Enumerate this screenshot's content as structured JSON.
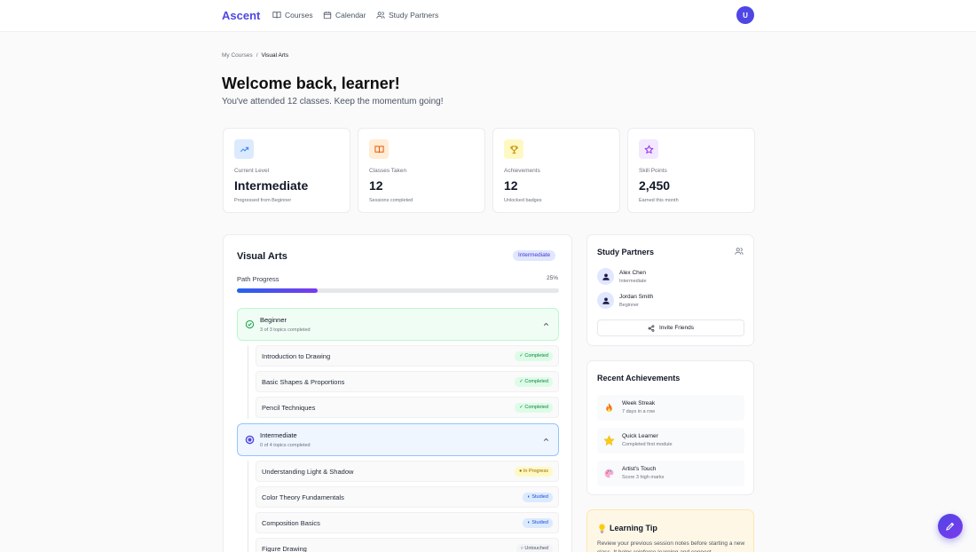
{
  "nav": {
    "brand": "Ascent",
    "items": [
      {
        "label": "Courses",
        "icon": "book-icon"
      },
      {
        "label": "Calendar",
        "icon": "calendar-icon"
      },
      {
        "label": "Study Partners",
        "icon": "users-icon"
      }
    ],
    "avatar_initial": "U"
  },
  "breadcrumb": {
    "parent": "My Courses",
    "separator": "/",
    "current": "Visual Arts"
  },
  "header": {
    "title": "Welcome back, learner!",
    "subtitle": "You've attended 12 classes. Keep the momentum going!"
  },
  "stats": [
    {
      "label": "Current Level",
      "value": "Intermediate",
      "sub": "Progressed from Beginner",
      "icon": "trending-up-icon",
      "color": "#3b82f6",
      "bg": "#dbeafe"
    },
    {
      "label": "Classes Taken",
      "value": "12",
      "sub": "Sessions completed",
      "icon": "book-open-icon",
      "color": "#ea580c",
      "bg": "#ffedd5"
    },
    {
      "label": "Achievements",
      "value": "12",
      "sub": "Unlocked badges",
      "icon": "trophy-icon",
      "color": "#ca8a04",
      "bg": "#fef9c3"
    },
    {
      "label": "Skill Points",
      "value": "2,450",
      "sub": "Earned this month",
      "icon": "star-icon",
      "color": "#9333ea",
      "bg": "#f3e8ff"
    }
  ],
  "course": {
    "title": "Visual Arts",
    "level_badge": "Intermediate",
    "progress_label": "Path Progress",
    "progress_text": "25%",
    "progress": 0.25,
    "sections": [
      {
        "title": "Beginner",
        "sub": "3 of 3 topics completed",
        "state": "done",
        "topics": [
          {
            "name": "Introduction to Drawing",
            "status": "✓ Completed"
          },
          {
            "name": "Basic Shapes & Proportions",
            "status": "✓ Completed"
          },
          {
            "name": "Pencil Techniques",
            "status": "✓ Completed"
          }
        ]
      },
      {
        "title": "Intermediate",
        "sub": "0 of 4 topics completed",
        "state": "active",
        "topics": [
          {
            "name": "Understanding Light & Shadow",
            "status": "● In Progress"
          },
          {
            "name": "Color Theory Fundamentals",
            "status": "◐ Studied"
          },
          {
            "name": "Composition Basics",
            "status": "◐ Studied"
          },
          {
            "name": "Figure Drawing",
            "status": "○ Untouched"
          }
        ]
      }
    ]
  },
  "partners": {
    "title": "Study Partners",
    "list": [
      {
        "name": "Alex Chen",
        "level": "Intermediate"
      },
      {
        "name": "Jordan Smith",
        "level": "Beginner"
      }
    ],
    "invite_label": "Invite Friends"
  },
  "achievements": {
    "title": "Recent Achievements",
    "list": [
      {
        "name": "Week Streak",
        "desc": "7 days in a row",
        "icon": "fire-icon"
      },
      {
        "name": "Quick Learner",
        "desc": "Completed first module",
        "icon": "star-emoji-icon"
      },
      {
        "name": "Artist's Touch",
        "desc": "Score 3 high marks",
        "icon": "palette-icon"
      }
    ]
  },
  "tip": {
    "title": "Learning Tip",
    "text": "Review your previous session notes before starting a new class. It helps reinforce learning and connect"
  },
  "status_colors": {
    "completed": {
      "fg": "#15803d",
      "bg": "#dcfce7"
    },
    "progress": {
      "fg": "#a16207",
      "bg": "#fef9c3"
    },
    "studied": {
      "fg": "#1d4ed8",
      "bg": "#dbeafe"
    },
    "untouched": {
      "fg": "#4b5563",
      "bg": "#f3f4f6"
    }
  }
}
